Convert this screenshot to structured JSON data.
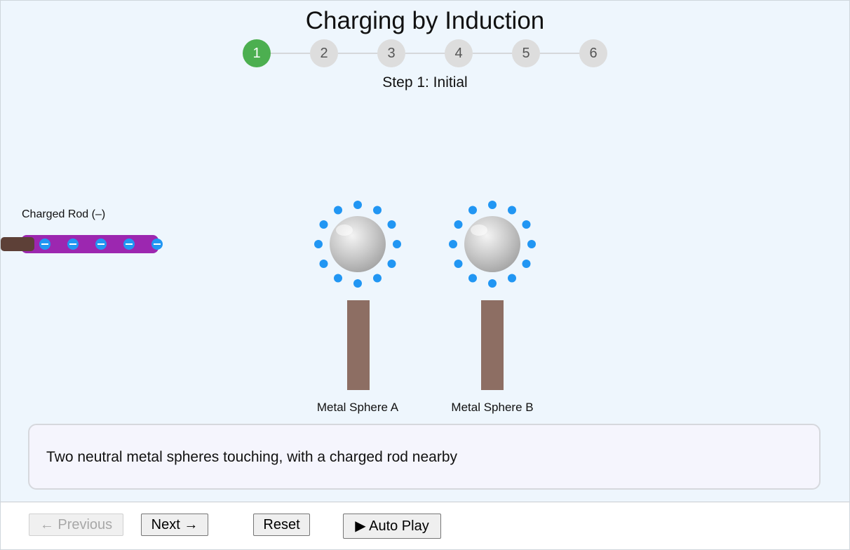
{
  "title": "Charging by Induction",
  "steps": [
    "1",
    "2",
    "3",
    "4",
    "5",
    "6"
  ],
  "current_step": 1,
  "step_label": "Step 1: Initial",
  "scene": {
    "rod_label": "Charged Rod (–)",
    "sphere_a_label": "Metal Sphere A",
    "sphere_b_label": "Metal Sphere B",
    "charge_sign": "–",
    "colors": {
      "rod": "#9c27b0",
      "handle": "#5d4037",
      "electron": "#2196f3",
      "stand": "#8d6e63",
      "active_step": "#4caf50",
      "inactive_step": "#dddddd"
    }
  },
  "description": "Two neutral metal spheres touching, with a charged rod nearby",
  "controls": {
    "previous": "← Previous",
    "next": "Next →",
    "reset": "Reset",
    "autoplay": "▶ Auto Play"
  }
}
